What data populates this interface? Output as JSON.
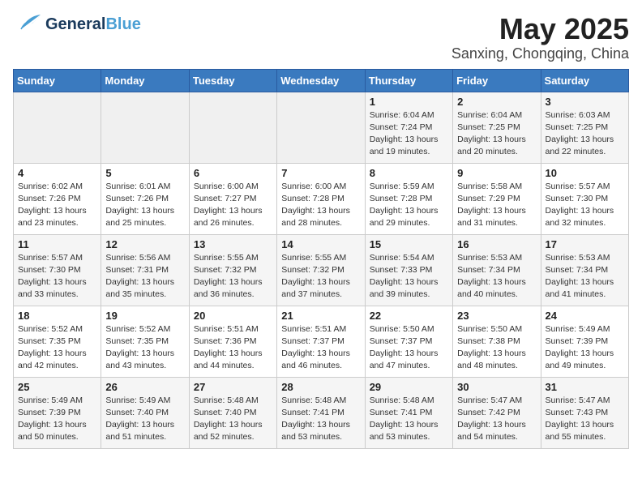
{
  "header": {
    "logo_general": "General",
    "logo_blue": "Blue",
    "title": "May 2025",
    "subtitle": "Sanxing, Chongqing, China"
  },
  "weekdays": [
    "Sunday",
    "Monday",
    "Tuesday",
    "Wednesday",
    "Thursday",
    "Friday",
    "Saturday"
  ],
  "weeks": [
    [
      {
        "day": "",
        "info": ""
      },
      {
        "day": "",
        "info": ""
      },
      {
        "day": "",
        "info": ""
      },
      {
        "day": "",
        "info": ""
      },
      {
        "day": "1",
        "info": "Sunrise: 6:04 AM\nSunset: 7:24 PM\nDaylight: 13 hours\nand 19 minutes."
      },
      {
        "day": "2",
        "info": "Sunrise: 6:04 AM\nSunset: 7:25 PM\nDaylight: 13 hours\nand 20 minutes."
      },
      {
        "day": "3",
        "info": "Sunrise: 6:03 AM\nSunset: 7:25 PM\nDaylight: 13 hours\nand 22 minutes."
      }
    ],
    [
      {
        "day": "4",
        "info": "Sunrise: 6:02 AM\nSunset: 7:26 PM\nDaylight: 13 hours\nand 23 minutes."
      },
      {
        "day": "5",
        "info": "Sunrise: 6:01 AM\nSunset: 7:26 PM\nDaylight: 13 hours\nand 25 minutes."
      },
      {
        "day": "6",
        "info": "Sunrise: 6:00 AM\nSunset: 7:27 PM\nDaylight: 13 hours\nand 26 minutes."
      },
      {
        "day": "7",
        "info": "Sunrise: 6:00 AM\nSunset: 7:28 PM\nDaylight: 13 hours\nand 28 minutes."
      },
      {
        "day": "8",
        "info": "Sunrise: 5:59 AM\nSunset: 7:28 PM\nDaylight: 13 hours\nand 29 minutes."
      },
      {
        "day": "9",
        "info": "Sunrise: 5:58 AM\nSunset: 7:29 PM\nDaylight: 13 hours\nand 31 minutes."
      },
      {
        "day": "10",
        "info": "Sunrise: 5:57 AM\nSunset: 7:30 PM\nDaylight: 13 hours\nand 32 minutes."
      }
    ],
    [
      {
        "day": "11",
        "info": "Sunrise: 5:57 AM\nSunset: 7:30 PM\nDaylight: 13 hours\nand 33 minutes."
      },
      {
        "day": "12",
        "info": "Sunrise: 5:56 AM\nSunset: 7:31 PM\nDaylight: 13 hours\nand 35 minutes."
      },
      {
        "day": "13",
        "info": "Sunrise: 5:55 AM\nSunset: 7:32 PM\nDaylight: 13 hours\nand 36 minutes."
      },
      {
        "day": "14",
        "info": "Sunrise: 5:55 AM\nSunset: 7:32 PM\nDaylight: 13 hours\nand 37 minutes."
      },
      {
        "day": "15",
        "info": "Sunrise: 5:54 AM\nSunset: 7:33 PM\nDaylight: 13 hours\nand 39 minutes."
      },
      {
        "day": "16",
        "info": "Sunrise: 5:53 AM\nSunset: 7:34 PM\nDaylight: 13 hours\nand 40 minutes."
      },
      {
        "day": "17",
        "info": "Sunrise: 5:53 AM\nSunset: 7:34 PM\nDaylight: 13 hours\nand 41 minutes."
      }
    ],
    [
      {
        "day": "18",
        "info": "Sunrise: 5:52 AM\nSunset: 7:35 PM\nDaylight: 13 hours\nand 42 minutes."
      },
      {
        "day": "19",
        "info": "Sunrise: 5:52 AM\nSunset: 7:35 PM\nDaylight: 13 hours\nand 43 minutes."
      },
      {
        "day": "20",
        "info": "Sunrise: 5:51 AM\nSunset: 7:36 PM\nDaylight: 13 hours\nand 44 minutes."
      },
      {
        "day": "21",
        "info": "Sunrise: 5:51 AM\nSunset: 7:37 PM\nDaylight: 13 hours\nand 46 minutes."
      },
      {
        "day": "22",
        "info": "Sunrise: 5:50 AM\nSunset: 7:37 PM\nDaylight: 13 hours\nand 47 minutes."
      },
      {
        "day": "23",
        "info": "Sunrise: 5:50 AM\nSunset: 7:38 PM\nDaylight: 13 hours\nand 48 minutes."
      },
      {
        "day": "24",
        "info": "Sunrise: 5:49 AM\nSunset: 7:39 PM\nDaylight: 13 hours\nand 49 minutes."
      }
    ],
    [
      {
        "day": "25",
        "info": "Sunrise: 5:49 AM\nSunset: 7:39 PM\nDaylight: 13 hours\nand 50 minutes."
      },
      {
        "day": "26",
        "info": "Sunrise: 5:49 AM\nSunset: 7:40 PM\nDaylight: 13 hours\nand 51 minutes."
      },
      {
        "day": "27",
        "info": "Sunrise: 5:48 AM\nSunset: 7:40 PM\nDaylight: 13 hours\nand 52 minutes."
      },
      {
        "day": "28",
        "info": "Sunrise: 5:48 AM\nSunset: 7:41 PM\nDaylight: 13 hours\nand 53 minutes."
      },
      {
        "day": "29",
        "info": "Sunrise: 5:48 AM\nSunset: 7:41 PM\nDaylight: 13 hours\nand 53 minutes."
      },
      {
        "day": "30",
        "info": "Sunrise: 5:47 AM\nSunset: 7:42 PM\nDaylight: 13 hours\nand 54 minutes."
      },
      {
        "day": "31",
        "info": "Sunrise: 5:47 AM\nSunset: 7:43 PM\nDaylight: 13 hours\nand 55 minutes."
      }
    ]
  ]
}
